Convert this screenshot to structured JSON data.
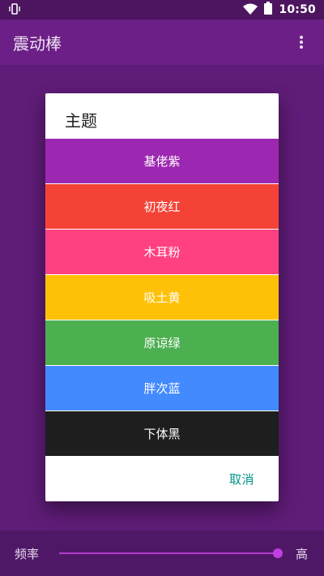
{
  "status_bar": {
    "time": "10:50",
    "icons": [
      "vibrate-icon",
      "wifi-icon",
      "battery-icon"
    ]
  },
  "app_bar": {
    "title": "震动棒",
    "overflow_icon": "more-vert-icon"
  },
  "dialog": {
    "title": "主题",
    "options": [
      {
        "label": "基佬紫",
        "color": "#9c27b0"
      },
      {
        "label": "初夜红",
        "color": "#f44336"
      },
      {
        "label": "木耳粉",
        "color": "#ff4081"
      },
      {
        "label": "吸土黄",
        "color": "#ffc107"
      },
      {
        "label": "原谅绿",
        "color": "#4caf50"
      },
      {
        "label": "胖次蓝",
        "color": "#448aff"
      },
      {
        "label": "下体黑",
        "color": "#1e1e1e"
      }
    ],
    "cancel_label": "取消"
  },
  "bottom_bar": {
    "label": "频率",
    "high_label": "高",
    "slider_value": 1.0
  },
  "colors": {
    "app_bar": "#6c1f86",
    "accent": "#009688"
  }
}
